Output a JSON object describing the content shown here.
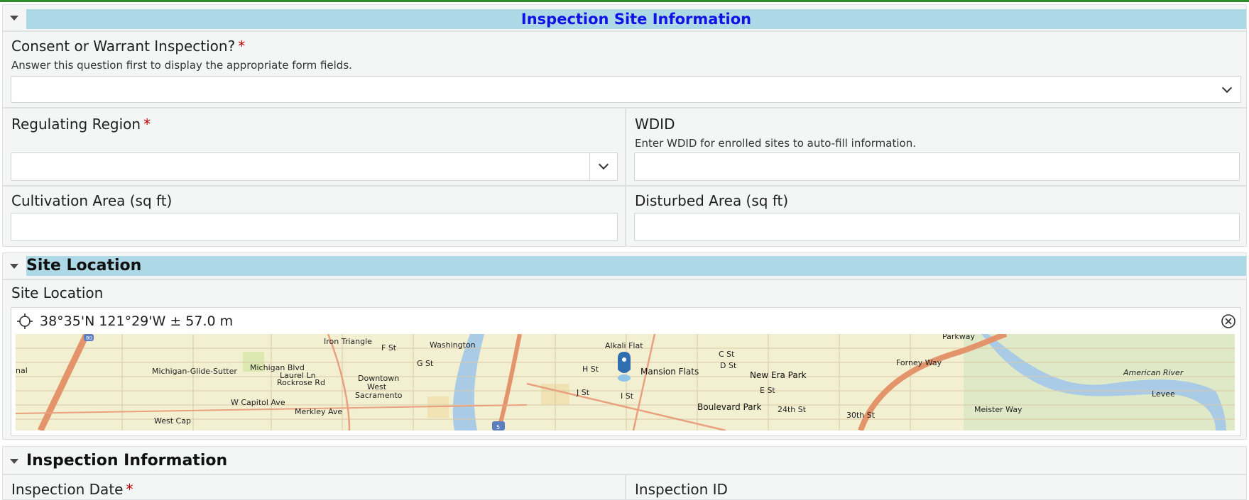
{
  "sections": {
    "inspection_site": {
      "title": "Inspection Site Information"
    },
    "site_location": {
      "title": "Site Location"
    },
    "inspection_info": {
      "title": "Inspection Information"
    }
  },
  "fields": {
    "consent": {
      "label": "Consent or Warrant Inspection?",
      "required_mark": "*",
      "hint": "Answer this question first to display the appropriate form fields.",
      "value": ""
    },
    "region": {
      "label": "Regulating Region",
      "required_mark": "*",
      "value": ""
    },
    "wdid": {
      "label": "WDID",
      "hint": "Enter WDID for enrolled sites to auto-fill information.",
      "value": ""
    },
    "cultivation": {
      "label": "Cultivation Area (sq ft)",
      "value": ""
    },
    "disturbed": {
      "label": "Disturbed Area (sq ft)",
      "value": ""
    },
    "site_location": {
      "label": "Site Location",
      "coordinates": "38°35'N 121°29'W ± 57.0 m"
    },
    "inspection_date": {
      "label": "Inspection Date",
      "required_mark": "*"
    },
    "inspection_id": {
      "label": "Inspection ID"
    }
  },
  "map": {
    "labels": {
      "iron_triangle": "Iron Triangle",
      "washington": "Washington",
      "alkali_flat": "Alkali Flat",
      "parkway": "Parkway",
      "michigan_glide": "Michigan-Glide-Sutter",
      "michigan_blvd": "Michigan Blvd",
      "laurel_ln": "Laurel Ln",
      "rockrose_rd": "Rockrose Rd",
      "downtown": "Downtown",
      "west": "West",
      "sacramento": "Sacramento",
      "w_capitol": "W Capitol Ave",
      "merkley": "Merkley Ave",
      "west_cap": "West Cap",
      "mansion_flats": "Mansion Flats",
      "new_era_park": "New Era Park",
      "boulevard_park": "Boulevard Park",
      "american_river": "American River",
      "c_st": "C St",
      "d_st": "D St",
      "e_st": "E St",
      "f_st": "F St",
      "g_st": "G St",
      "h_st": "H St",
      "j_st": "J St",
      "i_st": "I St",
      "st24": "24th St",
      "st30": "30th St",
      "forney": "Forney Way",
      "levee": "Levee",
      "meister": "Meister Way",
      "i80": "80",
      "i5": "5",
      "side_label": "nal"
    }
  },
  "colors": {
    "section_accent": "#add8e6",
    "title_blue": "#1212e6",
    "required": "#c00000",
    "top_line": "#2e8b2e"
  },
  "icons": [
    "caret-down-icon",
    "chevron-down-icon",
    "crosshair-icon",
    "clear-circle-icon",
    "map-pin-icon"
  ]
}
